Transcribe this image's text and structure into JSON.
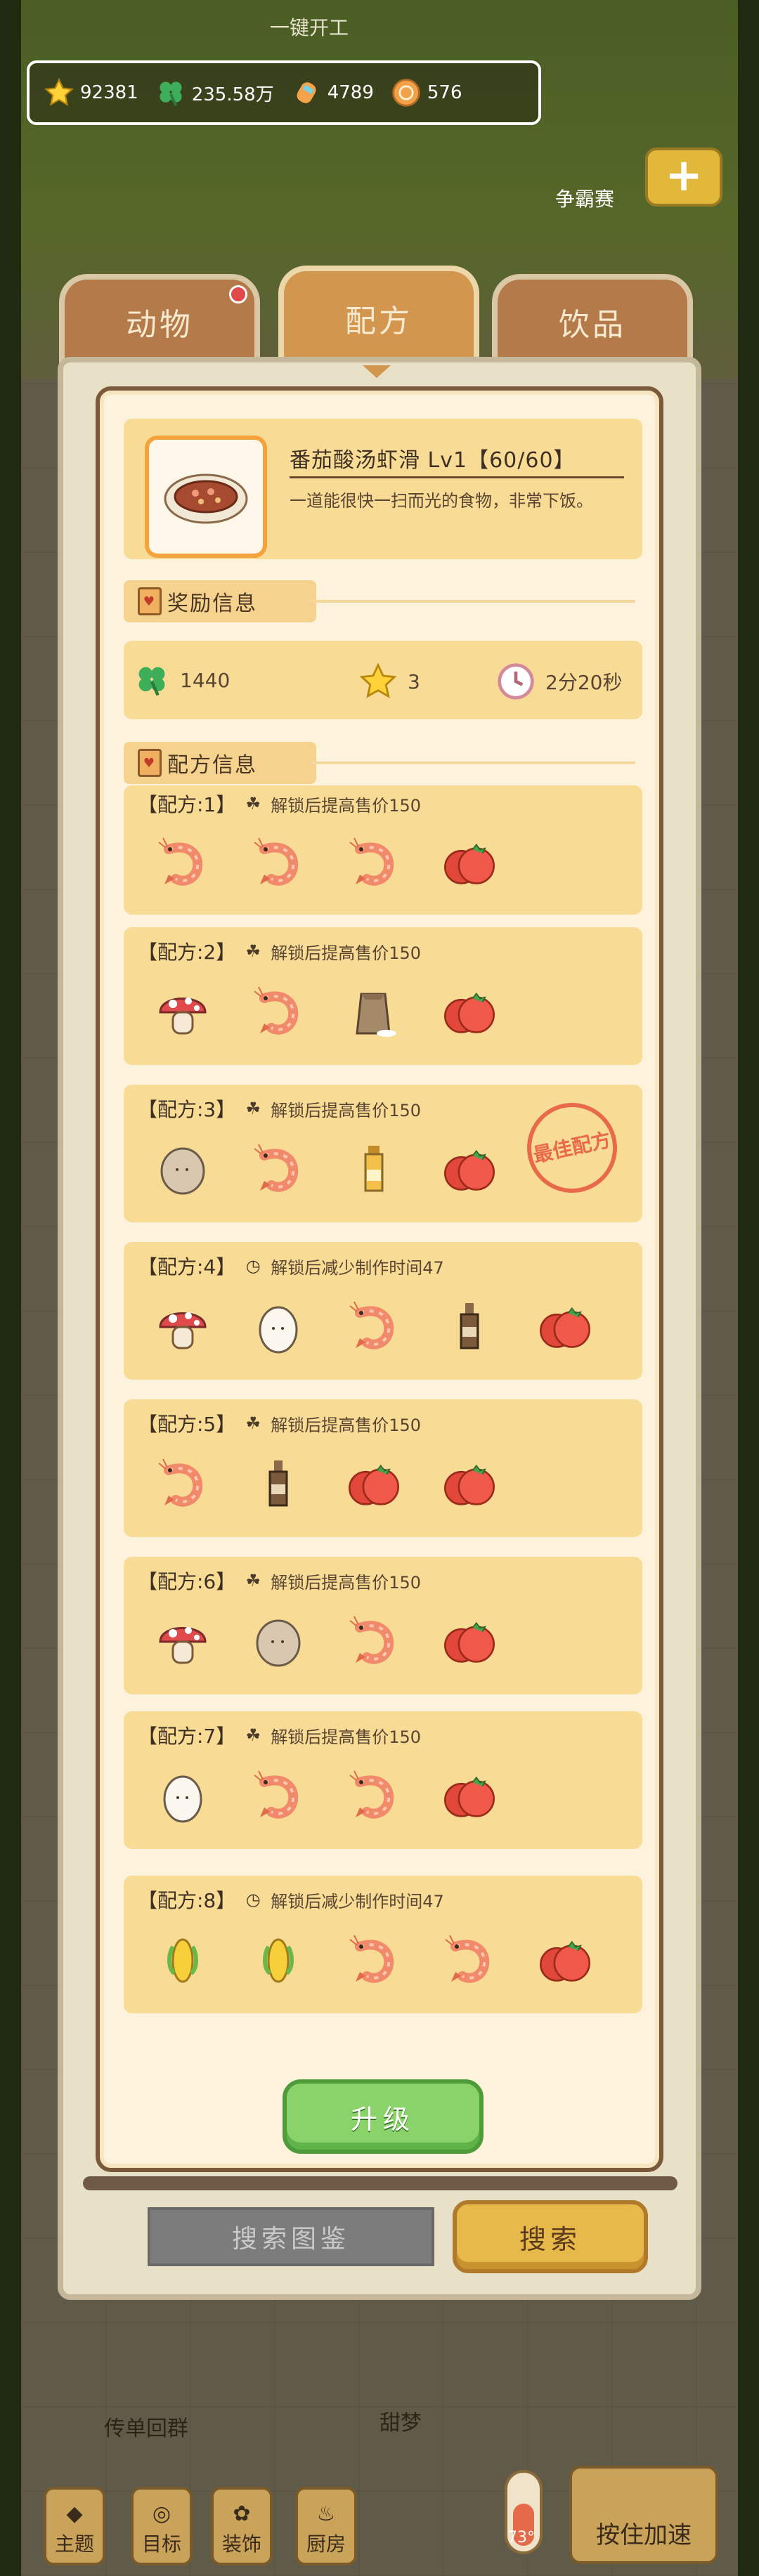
{
  "top_caption": "一键开工",
  "resources": [
    {
      "icon": "star-icon",
      "value": "92381"
    },
    {
      "icon": "clover-icon",
      "value": "235.58万"
    },
    {
      "icon": "candy-icon",
      "value": "4789"
    },
    {
      "icon": "coin-icon",
      "value": "576"
    }
  ],
  "score_label": "争霸赛",
  "tabs": [
    {
      "label": "动物"
    },
    {
      "label": "配方"
    },
    {
      "label": "饮品"
    }
  ],
  "recipe": {
    "title": "番茄酸汤虾滑 Lv1【60/60】",
    "description": "一道能很快一扫而光的食物，非常下饭。"
  },
  "reward_section": {
    "label": "奖励信息"
  },
  "rewards": [
    {
      "icon": "clover-icon",
      "value": "1440"
    },
    {
      "icon": "star-icon",
      "value": "3"
    },
    {
      "icon": "clock-icon",
      "value": "2分20秒"
    }
  ],
  "formula_section": {
    "label": "配方信息"
  },
  "formulas": [
    {
      "name": "【配方:1】",
      "bonus_icon": "clover-icon",
      "bonus": "解锁后提高售价150",
      "ingredients": [
        "shrimp",
        "shrimp",
        "shrimp",
        "tomato"
      ]
    },
    {
      "name": "【配方:2】",
      "bonus_icon": "clover-icon",
      "bonus": "解锁后提高售价150",
      "ingredients": [
        "mushroom",
        "shrimp",
        "flour-bag",
        "tomato"
      ]
    },
    {
      "name": "【配方:3】",
      "bonus_icon": "clover-icon",
      "bonus": "解锁后提高售价150",
      "ingredients": [
        "potato",
        "shrimp",
        "oil-bottle",
        "tomato"
      ],
      "stamp": "最佳配方"
    },
    {
      "name": "【配方:4】",
      "bonus_icon": "clock-icon",
      "bonus": "解锁后减少制作时间47",
      "ingredients": [
        "mushroom",
        "egg",
        "shrimp",
        "sauce-bottle",
        "tomato"
      ]
    },
    {
      "name": "【配方:5】",
      "bonus_icon": "clover-icon",
      "bonus": "解锁后提高售价150",
      "ingredients": [
        "shrimp",
        "sauce-bottle",
        "tomato",
        "tomato"
      ]
    },
    {
      "name": "【配方:6】",
      "bonus_icon": "clover-icon",
      "bonus": "解锁后提高售价150",
      "ingredients": [
        "mushroom",
        "potato",
        "shrimp",
        "tomato"
      ]
    },
    {
      "name": "【配方:7】",
      "bonus_icon": "clover-icon",
      "bonus": "解锁后提高售价150",
      "ingredients": [
        "egg",
        "shrimp",
        "shrimp",
        "tomato"
      ]
    },
    {
      "name": "【配方:8】",
      "bonus_icon": "clock-icon",
      "bonus": "解锁后减少制作时间47",
      "ingredients": [
        "corn",
        "corn",
        "shrimp",
        "shrimp",
        "tomato"
      ]
    }
  ],
  "upgrade_label": "升级",
  "search": {
    "placeholder": "搜索图鉴",
    "button": "搜索"
  },
  "bottom": {
    "caption_left": "传单回群",
    "caption_right": "甜梦",
    "nav": [
      {
        "label": "主题",
        "icon": "theme-icon"
      },
      {
        "label": "目标",
        "icon": "target-icon"
      },
      {
        "label": "装饰",
        "icon": "decor-icon"
      },
      {
        "label": "厨房",
        "icon": "kitchen-icon"
      }
    ],
    "accelerate_label": "按住加速",
    "temperature": "73°"
  }
}
